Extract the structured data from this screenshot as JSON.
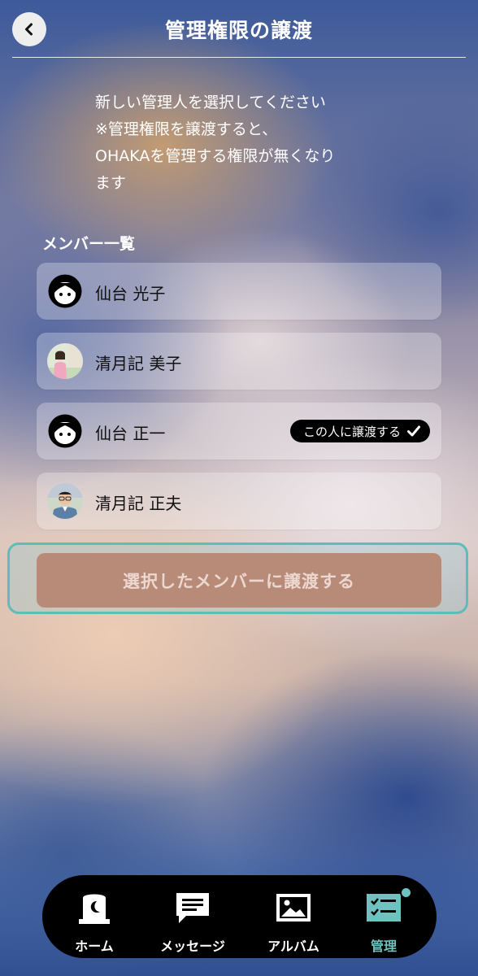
{
  "header": {
    "title": "管理権限の譲渡",
    "back_icon": "chevron-left-icon"
  },
  "notice": {
    "lines": [
      "新しい管理人を選択してください",
      "※管理権限を譲渡すると、",
      "OHAKAを管理する権限が無くなり",
      "ます"
    ]
  },
  "members": {
    "section_label": "メンバー一覧",
    "items": [
      {
        "name": "仙台 光子",
        "avatar": "default-avatar-icon",
        "selected": false
      },
      {
        "name": "清月記 美子",
        "avatar": "photo-avatar",
        "selected": false
      },
      {
        "name": "仙台 正一",
        "avatar": "default-avatar-icon",
        "selected": true
      },
      {
        "name": "清月記 正夫",
        "avatar": "photo-avatar",
        "selected": false
      }
    ],
    "selected_badge": "この人に譲渡する"
  },
  "transfer_button": {
    "label": "選択したメンバーに譲渡する",
    "color": "#b88a78"
  },
  "tabbar": {
    "tabs": [
      {
        "label": "ホーム",
        "icon": "grave-moon-icon",
        "active": false
      },
      {
        "label": "メッセージ",
        "icon": "message-icon",
        "active": false
      },
      {
        "label": "アルバム",
        "icon": "album-icon",
        "active": false
      },
      {
        "label": "管理",
        "icon": "checklist-icon",
        "active": true
      }
    ],
    "active_color": "#6fc2c0"
  }
}
